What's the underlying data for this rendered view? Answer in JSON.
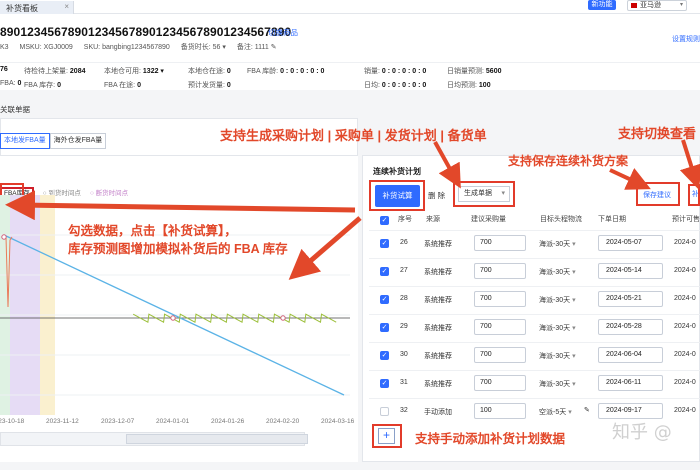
{
  "topbar": {
    "tab_label": "补货看板",
    "tab_close": "×",
    "new_button": "新功能",
    "region_label": "亚马逊"
  },
  "header": {
    "sku_title": "8901234567890123456789012345678901234567890",
    "switch_link": "切换商品",
    "settings_link": "设置规则",
    "meta": [
      "K3",
      "MSKU: XGJ0009",
      "SKU: bangbing1234567890",
      "备货时长: 56 ▾",
      "备注: 1111 ✎"
    ]
  },
  "stats": [
    {
      "label": "",
      "value": "76"
    },
    {
      "label": "待检待上架量:",
      "value": "2084"
    },
    {
      "label": "本地仓可用:",
      "value": "1322 ▾"
    },
    {
      "label": "本地仓在途:",
      "value": "0"
    },
    {
      "label": "FBA 库龄:",
      "value": "0 : 0 : 0 : 0 : 0"
    },
    {
      "label": "销量:",
      "value": "0 : 0 : 0 : 0 : 0"
    },
    {
      "label": "日销量预测:",
      "value": "5600"
    },
    {
      "label": "FBA:",
      "value": "0"
    },
    {
      "label": "FBA 库存:",
      "value": "0"
    },
    {
      "label": "FBA 在途:",
      "value": "0"
    },
    {
      "label": "预计发货量:",
      "value": "0"
    },
    {
      "label": "日均:",
      "value": "0 : 0 : 0 : 0 : 0"
    },
    {
      "label": "日均预测:",
      "value": "100"
    }
  ],
  "subnav": "关联单据",
  "toggles": [
    "本地发FBA量",
    "海外仓发FBA量"
  ],
  "legend": [
    "FBA库存",
    "○ 到货时间点",
    "○ 断货时间点"
  ],
  "chart_data": {
    "type": "line",
    "x_ticks": [
      "2023-10-18",
      "2023-11-12",
      "2023-12-07",
      "2024-01-01",
      "2024-01-26",
      "2024-02-20",
      "2024-03-16"
    ],
    "series": [
      {
        "name": "",
        "color": "#5bb3e6",
        "values": [
          {
            "t": 0,
            "y": 100
          },
          {
            "t": 1,
            "y": 0
          }
        ]
      },
      {
        "name": "",
        "color": "#9cbf3a",
        "values": [
          {
            "t": 0.38,
            "y": 48
          },
          {
            "t": 0.98,
            "y": 48
          }
        ]
      }
    ]
  },
  "right_panel": {
    "title": "连续补货计划",
    "trial_button": "补货试算",
    "delete_button": "删 除",
    "generate_select": "生成单据",
    "save_button": "保存建议",
    "switch_button": "补货",
    "columns": [
      "序号",
      "来源",
      "建议采购量",
      "目标头程物流",
      "下单日期",
      "预计可售"
    ],
    "rows": [
      {
        "no": "26",
        "source": "系统推荐",
        "qty": "700",
        "logistics": "海派-30天",
        "date": "2024-05-07",
        "sell": "2024-0",
        "checked": true
      },
      {
        "no": "27",
        "source": "系统推荐",
        "qty": "700",
        "logistics": "海派-30天",
        "date": "2024-05-14",
        "sell": "2024-0",
        "checked": true
      },
      {
        "no": "28",
        "source": "系统推荐",
        "qty": "700",
        "logistics": "海派-30天",
        "date": "2024-05-21",
        "sell": "2024-0",
        "checked": true
      },
      {
        "no": "29",
        "source": "系统推荐",
        "qty": "700",
        "logistics": "海派-30天",
        "date": "2024-05-28",
        "sell": "2024-0",
        "checked": true
      },
      {
        "no": "30",
        "source": "系统推荐",
        "qty": "700",
        "logistics": "海派-30天",
        "date": "2024-06-04",
        "sell": "2024-0",
        "checked": true
      },
      {
        "no": "31",
        "source": "系统推荐",
        "qty": "700",
        "logistics": "海派-30天",
        "date": "2024-06-11",
        "sell": "2024-0",
        "checked": true
      },
      {
        "no": "32",
        "source": "手动添加",
        "qty": "100",
        "logistics": "空派-5天",
        "date": "2024-09-17",
        "sell": "2024-0",
        "checked": false
      }
    ],
    "add_button": "+"
  },
  "annotations": {
    "a1": "支持生成采购计划 | 采购单 | 发货计划 | 备货单",
    "a2": "支持切换查看",
    "a3": "支持保存连续补货方案",
    "a4": "勾选数据，点击【补货试算】，",
    "a5": "库存预测图增加模拟补货后的 FBA 库存",
    "a6": "支持手动添加补货计划数据"
  },
  "watermark": "知乎 @",
  "colors": {
    "accent": "#2f6bff",
    "annotation": "#e2482a"
  }
}
